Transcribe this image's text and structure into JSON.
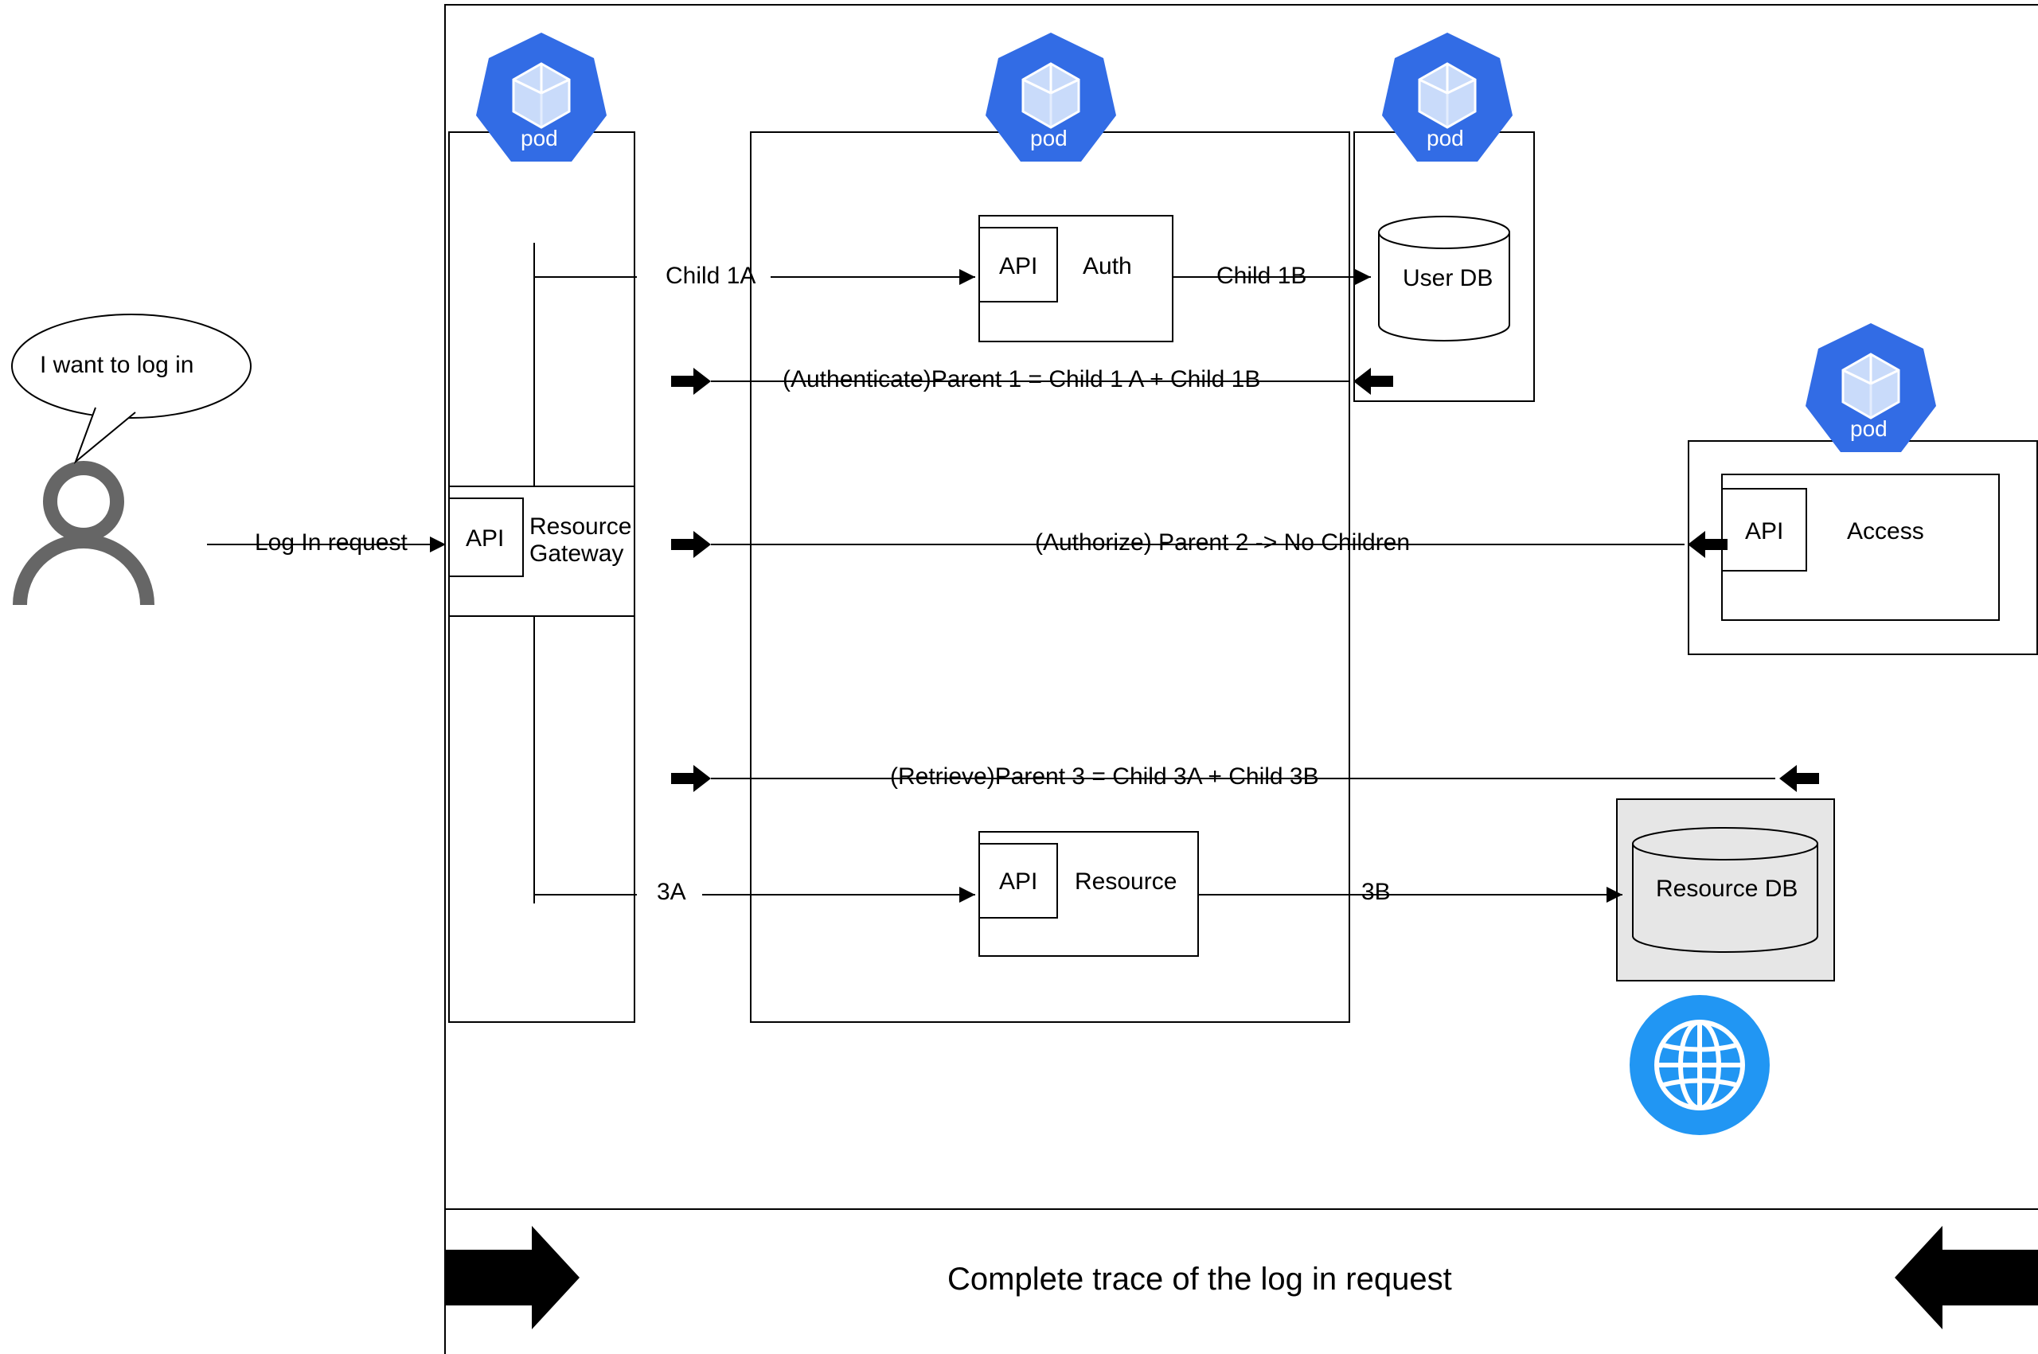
{
  "user": {
    "speech": "I want to log in"
  },
  "flow": {
    "login_request": "Log In request",
    "child1a": "Child 1A",
    "child1b": "Child 1B",
    "parent1": "(Authenticate)Parent 1 = Child 1 A + Child 1B",
    "parent2": "(Authorize) Parent 2 -> No Children",
    "parent3": "(Retrieve)Parent 3 = Child 3A + Child 3B",
    "child3a": "3A",
    "child3b": "3B"
  },
  "pods": {
    "gateway": {
      "api": "API",
      "name": "Resource Gateway"
    },
    "auth": {
      "api": "API",
      "name": "Auth"
    },
    "userdb": {
      "name": "User DB"
    },
    "access": {
      "api": "API",
      "name": "Access"
    },
    "resource": {
      "api": "API",
      "name": "Resource"
    },
    "resourcedb": {
      "name": "Resource DB"
    }
  },
  "pod_badge": "pod",
  "footer": "Complete trace of the log in request",
  "colors": {
    "k8s_blue": "#326CE5",
    "globe_blue": "#2196F3",
    "user_grey": "#666666"
  }
}
